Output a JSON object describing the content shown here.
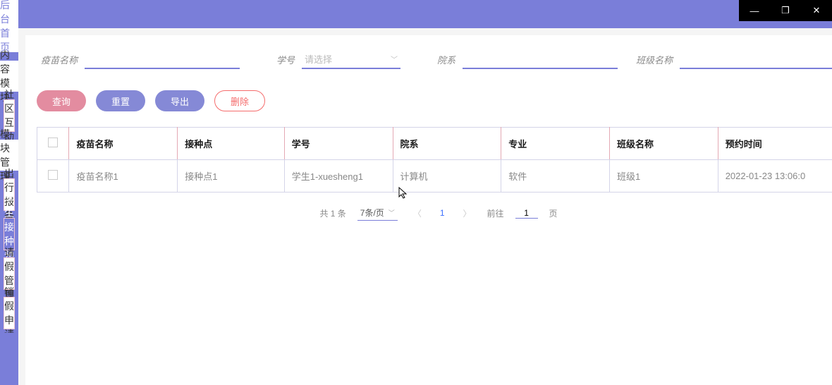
{
  "window": {
    "controls": {
      "minimize": "—",
      "maximize": "❐",
      "close": "✕"
    }
  },
  "sidebar": {
    "home": "后台首页",
    "sections": [
      {
        "header": "内容模块",
        "items": [
          "社区互动"
        ]
      },
      {
        "header": "模块管理",
        "items": [
          "出行报备",
          "学生接种预约",
          "请假管理",
          "销假申请"
        ]
      }
    ],
    "selected": "学生接种预约"
  },
  "filters": {
    "vaccine_name": {
      "label": "疫苗名称",
      "value": ""
    },
    "student_id": {
      "label": "学号",
      "placeholder": "请选择",
      "value": ""
    },
    "department": {
      "label": "院系",
      "value": ""
    },
    "class_name": {
      "label": "班级名称",
      "value": ""
    }
  },
  "buttons": {
    "query": "查询",
    "reset": "重置",
    "export": "导出",
    "delete": "删除"
  },
  "table": {
    "headers": [
      "疫苗名称",
      "接种点",
      "学号",
      "院系",
      "专业",
      "班级名称",
      "预约时间"
    ],
    "rows": [
      {
        "vaccine_name": "疫苗名称1",
        "point": "接种点1",
        "sid": "学生1-xuesheng1",
        "dept": "计算机",
        "major": "软件",
        "class_name": "班级1",
        "time": "2022-01-23 13:06:0"
      }
    ]
  },
  "pagination": {
    "total_text": "共 1 条",
    "page_size": "7条/页",
    "current": "1",
    "goto_label_pre": "前往",
    "goto_value": "1",
    "goto_label_post": "页"
  }
}
